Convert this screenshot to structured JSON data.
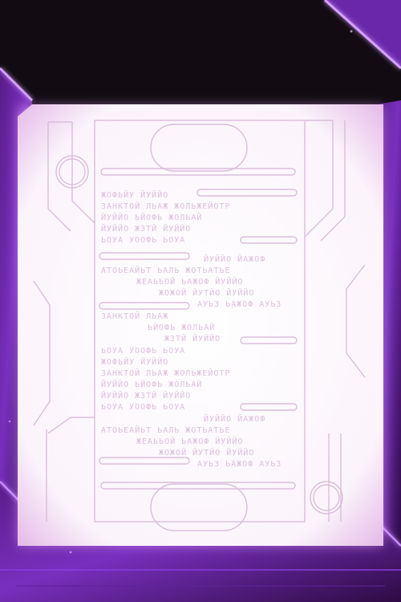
{
  "colors": {
    "background": "#120b12",
    "frame_purple": "#7d2cc4",
    "frame_purple_dark": "#3b0f5e",
    "glow": "#c77dff",
    "panel": "#f8f1f8",
    "line_art": "#d7b8d7"
  },
  "lines": [
    "ЖОФЬЙУ ЙУЙЙО",
    "ЗАНКТОЙ ЛЬАЖ ЖОЛЬЖЕЙОТР",
    "ЙУЙЙО ЬЙОФЬ ЖОЛЬАЙ",
    "ЙУЙЙО ЖЗТЙ ЙУЙЙО",
    "ЬОУА УООФЬ ЬОУА",
    "ЙУЙЙО ЙАЖОФ",
    "АТОЬЕАЙЬТ ЬАЛЬ ЖОТЬАТЬЕ",
    "ЖЕАЬЬОЙ ЬАЖОФ ЙУЙЙО",
    "ЖОЖОЙ ЙУТЙО ЙУЙЙО",
    "АУЬЗ ЬАЖОФ АУЬЗ",
    "ЗАНКТОЙ ЛЬАЖ",
    "ЬЙОФЬ ЖОЛЬАЙ",
    "ЖЗТЙ ЙУЙЙО",
    "ЬОУА УООФЬ ЬОУА",
    "ЖОФЬЙУ ЙУЙЙО",
    "ЗАНКТОЙ ЛЬАЖ ЖОЛЬЖЕЙОТР",
    "ЙУЙЙО ЬЙОФЬ ЖОЛЬАЙ",
    "ЙУЙЙО ЖЗТЙ ЙУЙЙО",
    "ЬОУА УООФЬ ЬОУА",
    "ЙУЙЙО ЙАЖОФ",
    "АТОЬЕАЙЬТ ЬАЛЬ ЖОТЬАТЬЕ",
    "ЖЕАЬЬОЙ ЬАЖОФ ЙУЙЙО",
    "ЖОЖОЙ ЙУТЙО ЙУЙЙО",
    "АУЬЗ ЬАЖОФ АУЬЗ"
  ]
}
